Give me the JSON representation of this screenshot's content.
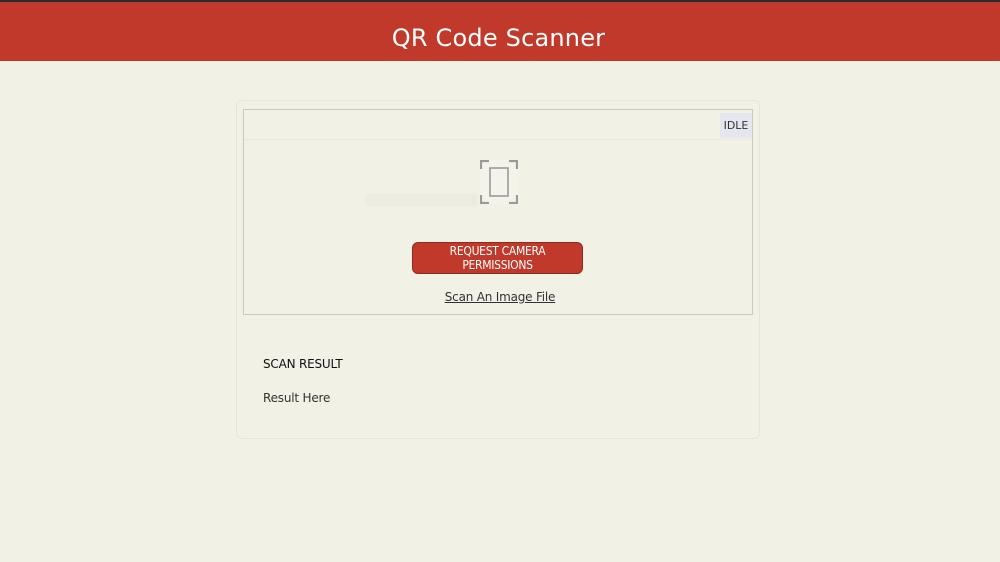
{
  "header": {
    "title": "QR Code Scanner"
  },
  "scanner": {
    "status": "IDLE",
    "icon": "qr-scan-frame-icon",
    "request_button_label": "REQUEST CAMERA PERMISSIONS",
    "scan_file_link": "Scan An Image File"
  },
  "result": {
    "heading": "SCAN RESULT",
    "text": "Result Here"
  },
  "colors": {
    "header_bg": "#c0392b",
    "page_bg": "#f1f1e6",
    "button_bg": "#c0392b"
  }
}
